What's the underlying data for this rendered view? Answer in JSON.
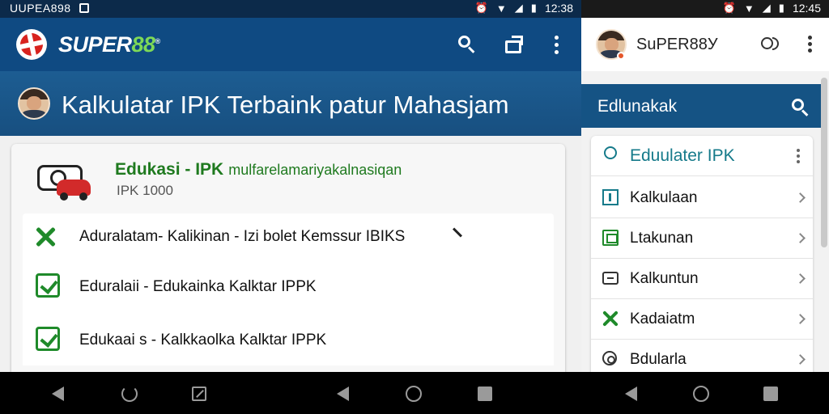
{
  "left": {
    "status_bar": {
      "carrier": "UUPEA898",
      "time": "12:38"
    },
    "app_bar": {
      "logo_text": "SUPER",
      "logo_text_accent": "88",
      "logo_mark": "®",
      "icons": [
        "search-icon",
        "share-icon",
        "more-vert-icon"
      ]
    },
    "title": "Kalkulatar IPK Terbaink patur Mahasjam",
    "card": {
      "title": "Edukasi - IPK",
      "title_suffix": "mulfarelamariyakalnasiqan",
      "subtitle": "IPK 1000",
      "rows": [
        {
          "icon": "tools-icon",
          "label": "Aduralatam- Kalikinan - Izi bolet Kemssur IBIKS"
        },
        {
          "icon": "check-icon",
          "label": "Eduralaii  - Edukainka Kalktar IPPK"
        },
        {
          "icon": "check-icon",
          "label": "Edukaai s - Kalkkaolka Kalktar IPPK"
        }
      ]
    }
  },
  "right": {
    "status_bar": {
      "time": "12:45"
    },
    "header": {
      "name": "SuPER88У"
    },
    "section_title": "Edlunakak",
    "list": {
      "head": {
        "icon": "lightbulb-icon",
        "label": "Eduulater IPK"
      },
      "items": [
        {
          "icon": "square-icon",
          "label": "Kalkulaan"
        },
        {
          "icon": "document-icon",
          "label": "Ltakunan"
        },
        {
          "icon": "calculator-icon",
          "label": "Kalkuntun"
        },
        {
          "icon": "tools-icon",
          "label": "Kadaiatm"
        },
        {
          "icon": "gear-icon",
          "label": "Bdularla"
        }
      ]
    }
  },
  "colors": {
    "primary": "#0f4a82",
    "accent_green": "#1f8a2a",
    "teal": "#157a8a",
    "logo_red": "#d8231f"
  }
}
